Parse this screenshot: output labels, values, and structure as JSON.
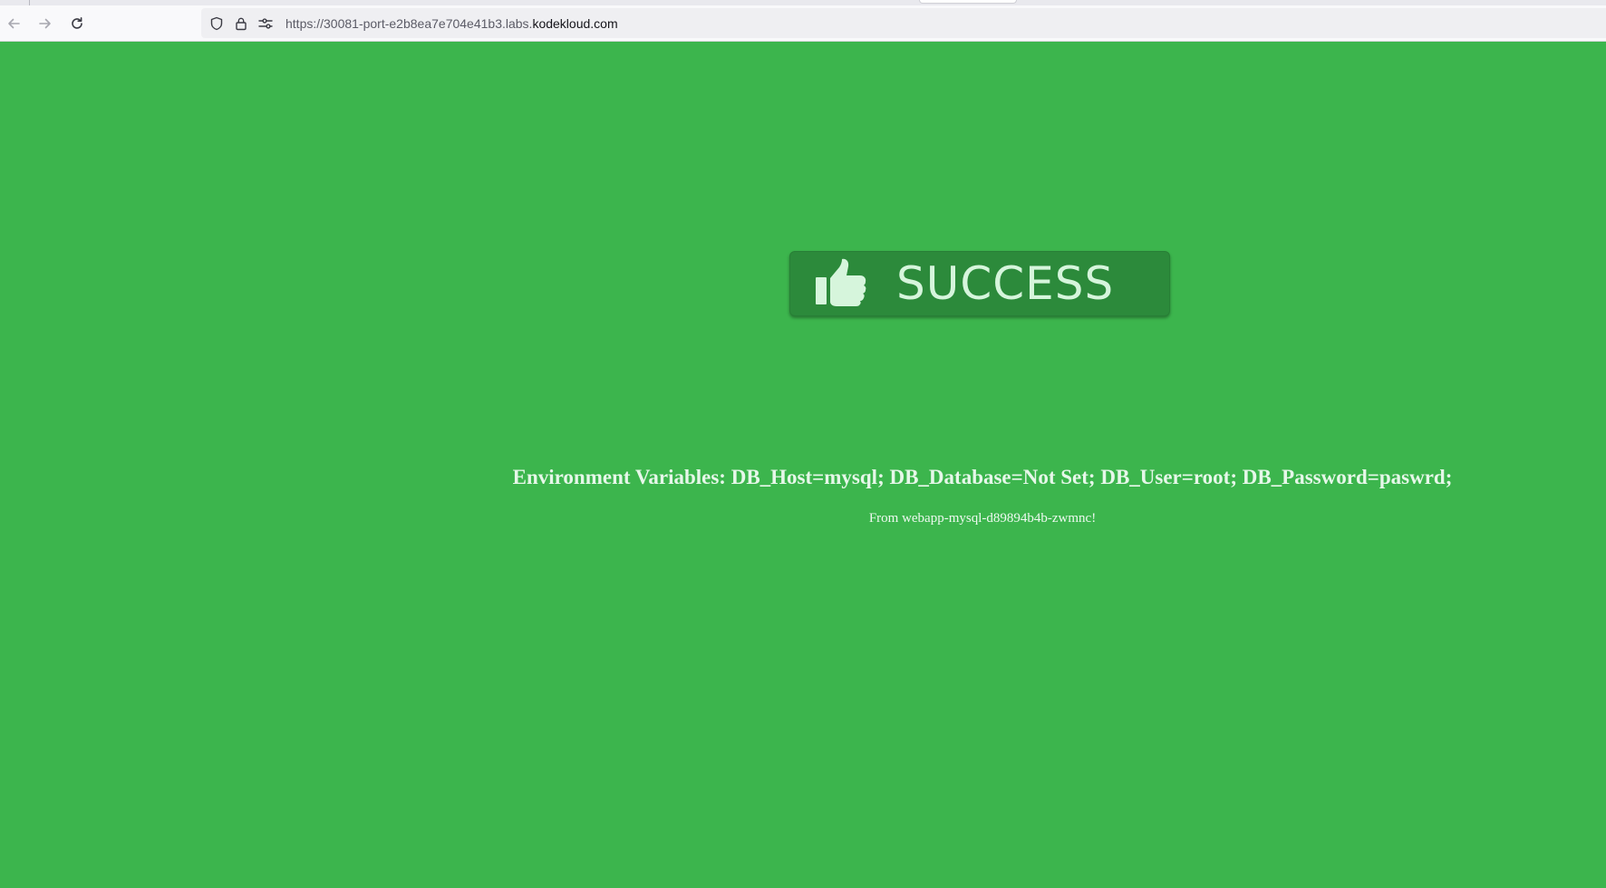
{
  "browser": {
    "url_prefix": "https://30081-port-e2b8ea7e704e41b3.labs.",
    "url_domain": "kodekloud.com",
    "icons": {
      "back": "arrow-left-icon",
      "forward": "arrow-right-icon",
      "reload": "reload-icon",
      "tracking": "shield-icon",
      "secure": "lock-icon",
      "permissions": "permissions-icon"
    }
  },
  "page": {
    "badge_label": "SUCCESS",
    "badge_icon": "thumbs-up-icon",
    "env_variables": "Environment Variables: DB_Host=mysql; DB_Database=Not Set; DB_User=root; DB_Password=paswrd;",
    "from_text": "From webapp-mysql-d89894b4b-zwmnc!",
    "colors": {
      "background": "#3cb54d",
      "badge": "#2c8a3b",
      "badge_text": "#d6f5dc"
    }
  }
}
